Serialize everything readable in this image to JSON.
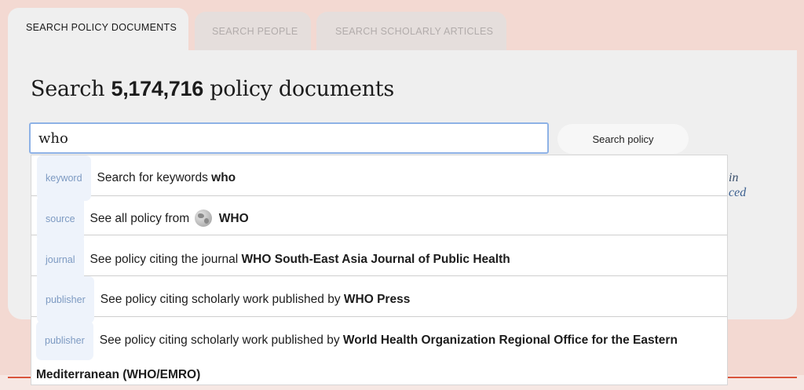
{
  "tabs": [
    {
      "label": "SEARCH POLICY DOCUMENTS",
      "active": true
    },
    {
      "label": "SEARCH PEOPLE",
      "active": false
    },
    {
      "label": "SEARCH SCHOLARLY ARTICLES",
      "active": false
    }
  ],
  "headline": {
    "prefix": "Search",
    "count": "5,174,716",
    "suffix": "policy documents"
  },
  "search": {
    "value": "who",
    "button_label": "Search policy"
  },
  "behind_text": {
    "line1": "in",
    "line2": "ced"
  },
  "suggestions": [
    {
      "badge": "keyword",
      "text": "Search for keywords ",
      "bold": "who"
    },
    {
      "badge": "source",
      "text": "See all policy from ",
      "bold": "WHO",
      "icon": "globe-icon"
    },
    {
      "badge": "journal",
      "text": "See policy citing the journal ",
      "bold": "WHO South-East Asia Journal of Public Health"
    },
    {
      "badge": "publisher",
      "text": "See policy citing scholarly work published by ",
      "bold": "WHO Press"
    },
    {
      "badge": "publisher",
      "text": "See policy citing scholarly work published by ",
      "bold": "World Health Organization Regional Office for the Eastern Mediterranean (WHO/EMRO)"
    }
  ]
}
